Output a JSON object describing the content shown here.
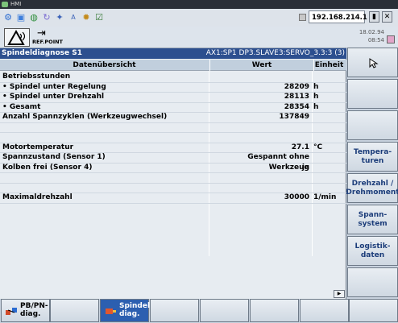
{
  "window": {
    "title": "HMI"
  },
  "toolbar": {
    "ip_address": "192.168.214.1"
  },
  "header": {
    "ref_label": "REF.POINT",
    "date": "18.02.94",
    "time": "08:54"
  },
  "panel": {
    "title": "Spindeldiagnose S1",
    "axis_info": "AX1:SP1 DP3.SLAVE3:SERVO_3.3:3 (3)",
    "col_overview": "Datenübersicht",
    "col_value": "Wert",
    "col_unit": "Einheit",
    "rows": [
      {
        "name": "Betriebsstunden",
        "value": "",
        "unit": ""
      },
      {
        "name": "• Spindel unter Regelung",
        "value": "28209",
        "unit": "h"
      },
      {
        "name": "• Spindel unter Drehzahl",
        "value": "28113",
        "unit": "h"
      },
      {
        "name": "• Gesamt",
        "value": "28354",
        "unit": "h"
      },
      {
        "name": "Anzahl Spannzyklen (Werkzeugwechsel)",
        "value": "137849",
        "unit": ""
      },
      {
        "name": "",
        "value": "",
        "unit": ""
      },
      {
        "name": "Motortemperatur",
        "value": "27.1",
        "unit": "°C"
      },
      {
        "name": "Spannzustand (Sensor 1)",
        "value": "Gespannt ohne Werkzeug",
        "unit": ""
      },
      {
        "name": "Kolben frei (Sensor 4)",
        "value": "ja",
        "unit": ""
      },
      {
        "name": "",
        "value": "",
        "unit": ""
      },
      {
        "name": "Maximaldrehzahl",
        "value": "30000",
        "unit": "1/min"
      }
    ]
  },
  "vertical_softkeys": [
    "",
    "",
    "",
    "Tempera-\nturen",
    "Drehzahl /\nDrehmoment",
    "Spann-\nsystem",
    "Logistik-\ndaten",
    ""
  ],
  "horizontal_softkeys": [
    {
      "label": "PB/PN-\ndiag.",
      "active": false
    },
    {
      "label": "",
      "active": false
    },
    {
      "label": "Spindel\ndiag.",
      "active": true
    },
    {
      "label": "",
      "active": false
    },
    {
      "label": "",
      "active": false
    },
    {
      "label": "",
      "active": false
    },
    {
      "label": "",
      "active": false
    },
    {
      "label": "",
      "active": false
    }
  ],
  "icons": {
    "toolbar": [
      "network-icon",
      "window-icon",
      "globe-icon",
      "refresh-icon",
      "tools-icon",
      "text-icon",
      "gear-icon",
      "checkbox-icon"
    ],
    "colors": {
      "header_blue": "#2c4f8f",
      "active_softkey": "#2c5fb0"
    }
  }
}
